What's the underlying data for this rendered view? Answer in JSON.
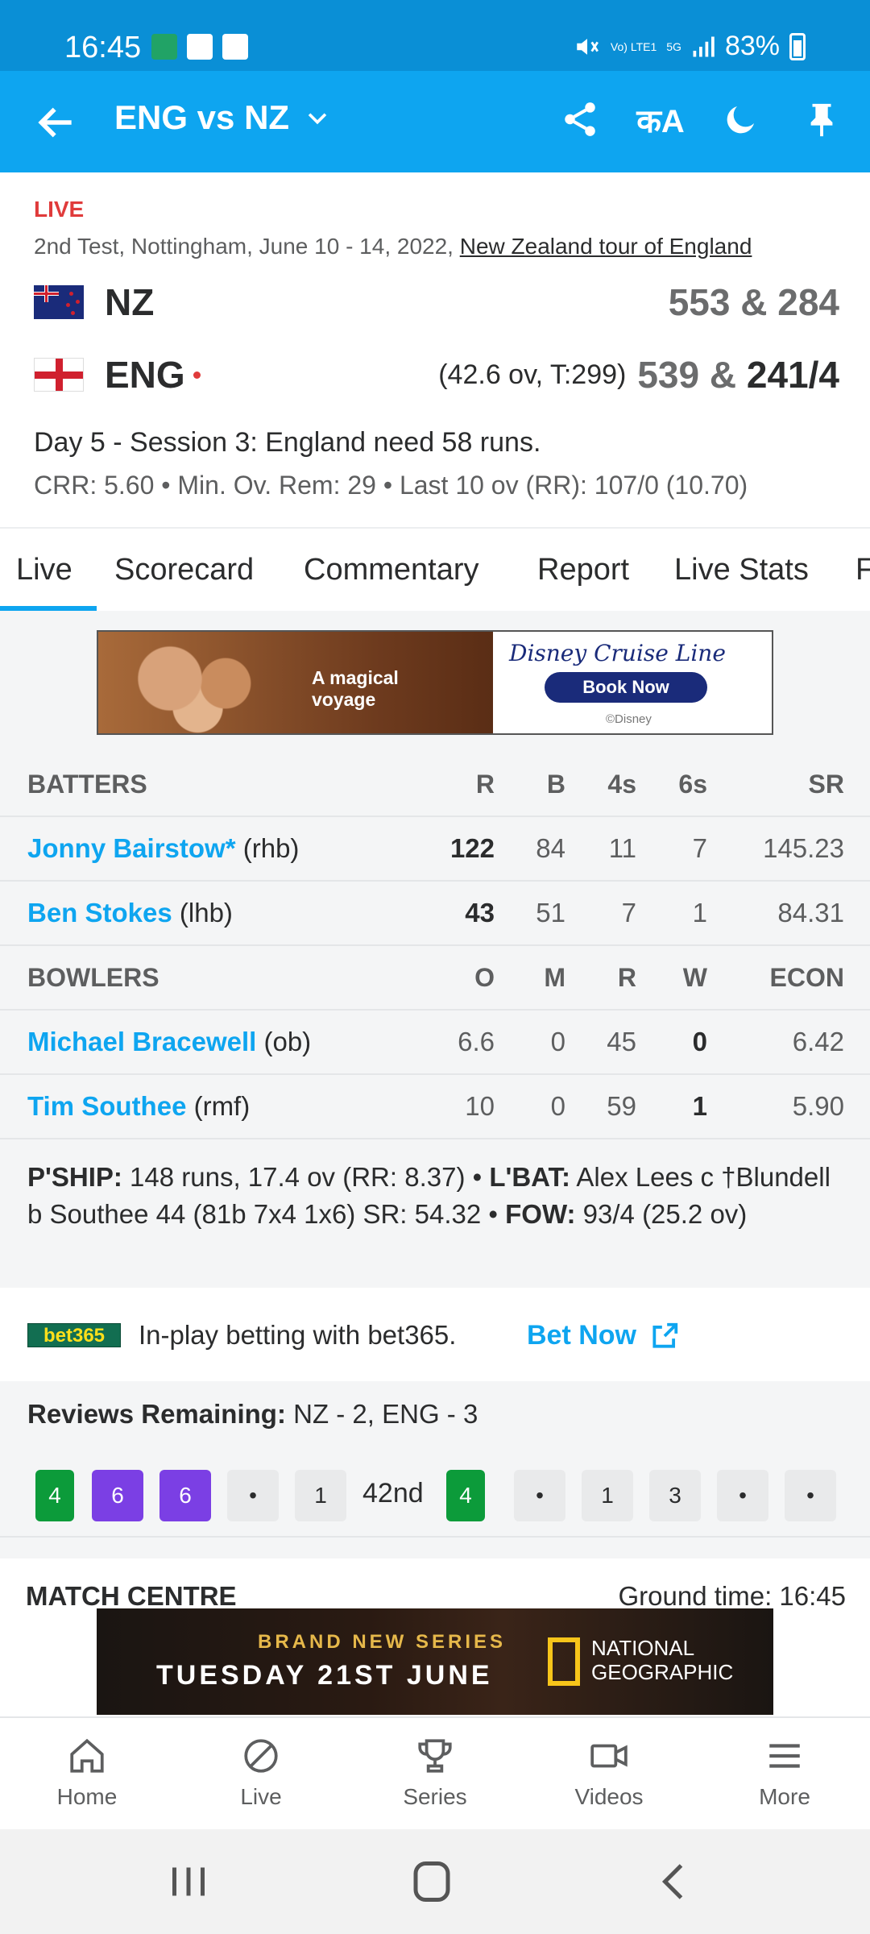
{
  "status_bar": {
    "time": "16:45",
    "battery": "83%",
    "network": "5G",
    "volte": "Vo) LTE1"
  },
  "app_bar": {
    "title": "ENG vs NZ",
    "translate_label": "कA"
  },
  "match": {
    "live_label": "LIVE",
    "info": "2nd Test, Nottingham, June 10 - 14, 2022, ",
    "tour": "New Zealand tour of England",
    "teams": [
      {
        "name": "NZ",
        "score": "553 & 284"
      },
      {
        "name": "ENG",
        "overs": "(42.6 ov, T:299)",
        "score_prev": "539 & ",
        "score_cur": "241/4"
      }
    ],
    "status": "Day 5 - Session 3: England need 58 runs.",
    "run_rates": "CRR: 5.60 • Min. Ov. Rem: 29 • Last 10 ov (RR): 107/0 (10.70)"
  },
  "tabs": [
    "Live",
    "Scorecard",
    "Commentary",
    "Report",
    "Live Stats",
    "F"
  ],
  "ad1": {
    "tagline_1": "A magical",
    "tagline_2": "voyage",
    "brand": "Disney Cruise Line",
    "button": "Book Now",
    "copyright": "©Disney"
  },
  "batters": {
    "header": {
      "label": "BATTERS",
      "cols": [
        "R",
        "B",
        "4s",
        "6s",
        "SR"
      ]
    },
    "rows": [
      {
        "name": "Jonny Bairstow*",
        "style": " (rhb)",
        "r": "122",
        "b": "84",
        "fours": "11",
        "sixes": "7",
        "sr": "145.23"
      },
      {
        "name": "Ben Stokes",
        "style": " (lhb)",
        "r": "43",
        "b": "51",
        "fours": "7",
        "sixes": "1",
        "sr": "84.31"
      }
    ]
  },
  "bowlers": {
    "header": {
      "label": "BOWLERS",
      "cols": [
        "O",
        "M",
        "R",
        "W",
        "ECON"
      ]
    },
    "rows": [
      {
        "name": "Michael Bracewell",
        "style": " (ob)",
        "o": "6.6",
        "m": "0",
        "r": "45",
        "w": "0",
        "econ": "6.42"
      },
      {
        "name": "Tim Southee",
        "style": " (rmf)",
        "o": "10",
        "m": "0",
        "r": "59",
        "w": "1",
        "econ": "5.90"
      }
    ]
  },
  "partnership": {
    "pship_label": "P'SHIP:",
    "pship": " 148 runs, 17.4 ov (RR: 8.37) • ",
    "lbat_label": "L'BAT:",
    "lbat": " Alex Lees c †Blundell b Southee 44 (81b 7x4 1x6) SR: 54.32 • ",
    "fow_label": "FOW:",
    "fow": " 93/4 (25.2 ov)"
  },
  "bet": {
    "logo": "bet365",
    "text": "In-play betting with bet365.",
    "link": "Bet Now"
  },
  "reviews": {
    "label": "Reviews Remaining:",
    "value": " NZ - 2, ENG - 3"
  },
  "balls": {
    "before": [
      "4",
      "6",
      "6",
      "•",
      "1"
    ],
    "over_label": "42nd",
    "after": [
      "4",
      "•",
      "1",
      "3",
      "•",
      "•"
    ]
  },
  "match_centre": {
    "title": "MATCH CENTRE",
    "ground_time": "Ground time: 16:45"
  },
  "ad2": {
    "top": "BRAND NEW SERIES",
    "main": "TUESDAY 21ST JUNE",
    "brand_1": "NATIONAL",
    "brand_2": "GEOGRAPHIC"
  },
  "bottom_nav": [
    "Home",
    "Live",
    "Series",
    "Videos",
    "More"
  ],
  "colors": {
    "app_bar": "#0ea5f0",
    "link": "#0ea5f0",
    "live": "#e03b3b",
    "four": "#0c9b3a",
    "six": "#7b3fe4"
  }
}
